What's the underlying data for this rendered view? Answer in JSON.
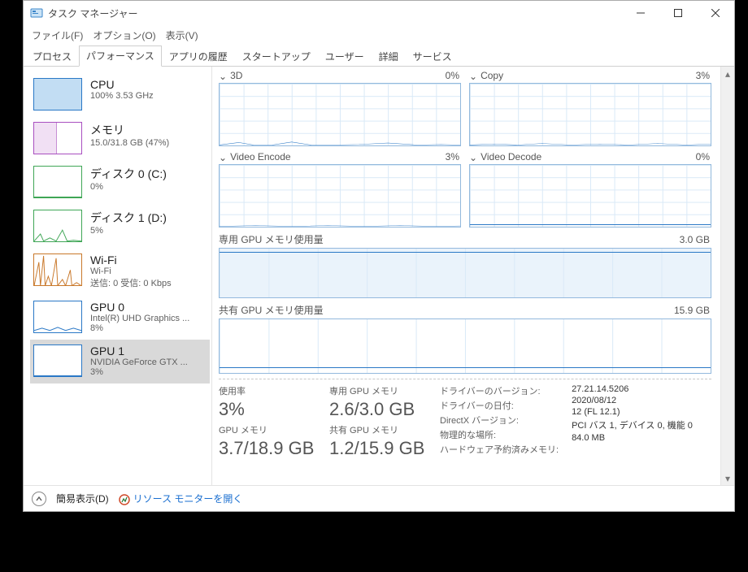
{
  "window": {
    "title": "タスク マネージャー"
  },
  "menus": [
    "ファイル(F)",
    "オプション(O)",
    "表示(V)"
  ],
  "tabs": [
    "プロセス",
    "パフォーマンス",
    "アプリの履歴",
    "スタートアップ",
    "ユーザー",
    "詳細",
    "サービス"
  ],
  "active_tab_index": 1,
  "sidebar": {
    "items": [
      {
        "title": "CPU",
        "sub": "100%  3.53 GHz"
      },
      {
        "title": "メモリ",
        "sub": "15.0/31.8 GB (47%)"
      },
      {
        "title": "ディスク 0 (C:)",
        "sub": "0%"
      },
      {
        "title": "ディスク 1 (D:)",
        "sub": "5%"
      },
      {
        "title": "Wi-Fi",
        "sub": "Wi-Fi",
        "sub2": "送信: 0  受信: 0 Kbps"
      },
      {
        "title": "GPU 0",
        "sub": "Intel(R) UHD Graphics ...",
        "sub2": "8%"
      },
      {
        "title": "GPU 1",
        "sub": "NVIDIA GeForce GTX ...",
        "sub2": "3%"
      }
    ],
    "selected_index": 6
  },
  "gpu_engines": {
    "panels": [
      {
        "name": "3D",
        "pct": "0%"
      },
      {
        "name": "Copy",
        "pct": "3%"
      },
      {
        "name": "Video Encode",
        "pct": "3%"
      },
      {
        "name": "Video Decode",
        "pct": "0%"
      }
    ],
    "dedicated": {
      "label": "専用 GPU メモリ使用量",
      "max": "3.0 GB"
    },
    "shared": {
      "label": "共有 GPU メモリ使用量",
      "max": "15.9 GB"
    }
  },
  "stats": {
    "big": [
      {
        "label": "使用率",
        "value": "3%"
      },
      {
        "label": "専用 GPU メモリ",
        "value": "2.6/3.0 GB"
      },
      {
        "label": "GPU メモリ",
        "value": "3.7/18.9 GB"
      },
      {
        "label": "共有 GPU メモリ",
        "value": "1.2/15.9 GB"
      }
    ],
    "kv": {
      "keys": [
        "ドライバーのバージョン:",
        "ドライバーの日付:",
        "DirectX バージョン:",
        "物理的な場所:",
        "ハードウェア予約済みメモリ:"
      ],
      "vals": [
        "27.21.14.5206",
        "2020/08/12",
        "12 (FL 12.1)",
        "PCI バス 1, デバイス 0, 機能 0",
        "84.0 MB"
      ]
    }
  },
  "footer": {
    "simple_view": "簡易表示(D)",
    "resource_monitor": "リソース モニターを開く"
  }
}
